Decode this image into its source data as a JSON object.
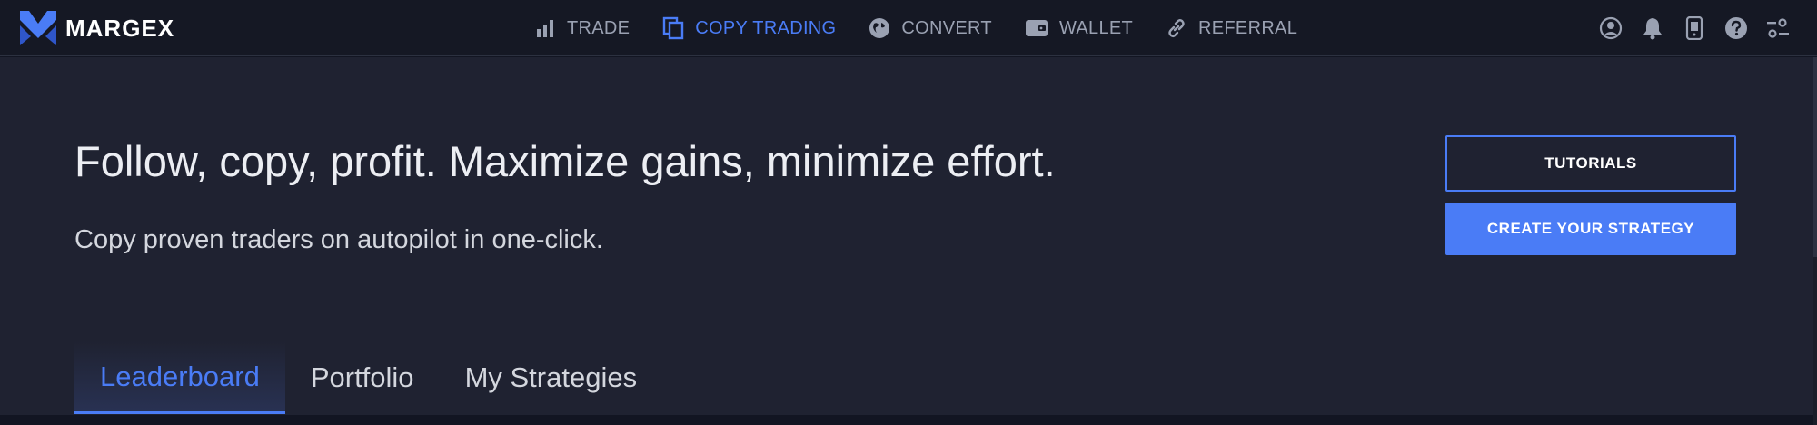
{
  "brand": {
    "name": "MARGEX",
    "logo_colors": {
      "primary": "#4a7cf6",
      "secondary": "#2f56c9"
    }
  },
  "nav": {
    "items": [
      {
        "label": "TRADE",
        "icon": "bar-chart-icon",
        "active": false
      },
      {
        "label": "COPY TRADING",
        "icon": "copy-icon",
        "active": true
      },
      {
        "label": "CONVERT",
        "icon": "globe-icon",
        "active": false
      },
      {
        "label": "WALLET",
        "icon": "wallet-icon",
        "active": false
      },
      {
        "label": "REFERRAL",
        "icon": "link-icon",
        "active": false
      }
    ],
    "right_icons": [
      "user-circle-icon",
      "bell-icon",
      "mobile-icon",
      "help-icon",
      "settings-sliders-icon"
    ]
  },
  "hero": {
    "headline": "Follow, copy, profit. Maximize gains, minimize effort.",
    "subline": "Copy proven traders on autopilot in one-click.",
    "tutorials_label": "TUTORIALS",
    "create_strategy_label": "CREATE YOUR STRATEGY"
  },
  "tabs": [
    {
      "label": "Leaderboard",
      "active": true
    },
    {
      "label": "Portfolio",
      "active": false
    },
    {
      "label": "My Strategies",
      "active": false
    }
  ],
  "colors": {
    "accent": "#4a7cf6",
    "nav_bg": "#151824",
    "page_bg": "#1f2231",
    "text_primary": "#eceef3",
    "text_muted": "#9aa1b2"
  }
}
